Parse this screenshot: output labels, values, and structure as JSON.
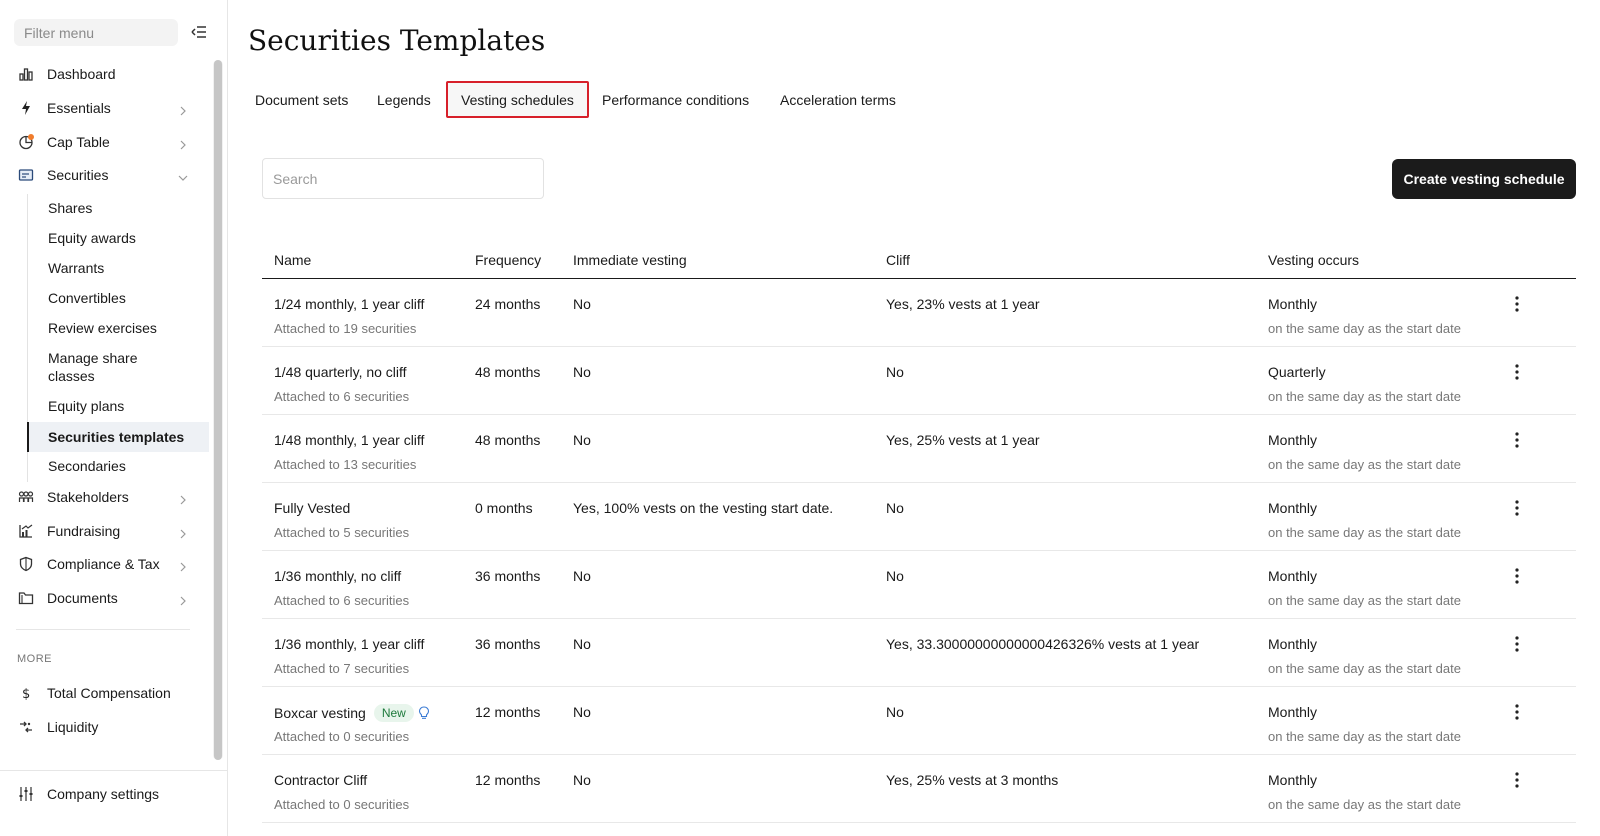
{
  "sidebar": {
    "filter_placeholder": "Filter menu",
    "items": [
      {
        "label": "Dashboard"
      },
      {
        "label": "Essentials"
      },
      {
        "label": "Cap Table"
      },
      {
        "label": "Securities"
      },
      {
        "label": "Stakeholders"
      },
      {
        "label": "Fundraising"
      },
      {
        "label": "Compliance & Tax"
      },
      {
        "label": "Documents"
      }
    ],
    "securities_sub": [
      "Shares",
      "Equity awards",
      "Warrants",
      "Convertibles",
      "Review exercises",
      "Manage share classes",
      "Equity plans",
      "Securities templates",
      "Secondaries"
    ],
    "more_label": "MORE",
    "more_items": [
      {
        "label": "Total Compensation"
      },
      {
        "label": "Liquidity"
      }
    ],
    "company_settings": "Company settings",
    "notification_color": "#f07c2c"
  },
  "page": {
    "title": "Securities Templates",
    "tabs": [
      "Document sets",
      "Legends",
      "Vesting schedules",
      "Performance conditions",
      "Acceleration terms"
    ],
    "active_tab": "Vesting schedules",
    "search_placeholder": "Search",
    "create_button": "Create vesting schedule"
  },
  "table": {
    "headers": {
      "name": "Name",
      "frequency": "Frequency",
      "immediate": "Immediate vesting",
      "cliff": "Cliff",
      "vesting": "Vesting occurs"
    },
    "rows": [
      {
        "name": "1/24 monthly, 1 year cliff",
        "attached": "Attached to 19 securities",
        "frequency": "24 months",
        "immediate": "No",
        "cliff": "Yes, 23% vests at 1 year",
        "vesting": "Monthly",
        "vesting_sub": "on the same day as the start date"
      },
      {
        "name": "1/48 quarterly, no cliff",
        "attached": "Attached to 6 securities",
        "frequency": "48 months",
        "immediate": "No",
        "cliff": "No",
        "vesting": "Quarterly",
        "vesting_sub": "on the same day as the start date"
      },
      {
        "name": "1/48 monthly, 1 year cliff",
        "attached": "Attached to 13 securities",
        "frequency": "48 months",
        "immediate": "No",
        "cliff": "Yes, 25% vests at 1 year",
        "vesting": "Monthly",
        "vesting_sub": "on the same day as the start date"
      },
      {
        "name": "Fully Vested",
        "attached": "Attached to 5 securities",
        "frequency": "0 months",
        "immediate": "Yes, 100% vests on the vesting start date.",
        "cliff": "No",
        "vesting": "Monthly",
        "vesting_sub": "on the same day as the start date"
      },
      {
        "name": "1/36 monthly, no cliff",
        "attached": "Attached to 6 securities",
        "frequency": "36 months",
        "immediate": "No",
        "cliff": "No",
        "vesting": "Monthly",
        "vesting_sub": "on the same day as the start date"
      },
      {
        "name": "1/36 monthly, 1 year cliff",
        "attached": "Attached to 7 securities",
        "frequency": "36 months",
        "immediate": "No",
        "cliff": "Yes, 33.300000000000004263​26% vests at 1 year",
        "vesting": "Monthly",
        "vesting_sub": "on the same day as the start date"
      },
      {
        "name": "Boxcar vesting",
        "badge": "New",
        "attached": "Attached to 0 securities",
        "frequency": "12 months",
        "immediate": "No",
        "cliff": "No",
        "vesting": "Monthly",
        "vesting_sub": "on the same day as the start date"
      },
      {
        "name": "Contractor Cliff",
        "attached": "Attached to 0 securities",
        "frequency": "12 months",
        "immediate": "No",
        "cliff": "Yes, 25% vests at 3 months",
        "vesting": "Monthly",
        "vesting_sub": "on the same day as the start date"
      }
    ]
  }
}
